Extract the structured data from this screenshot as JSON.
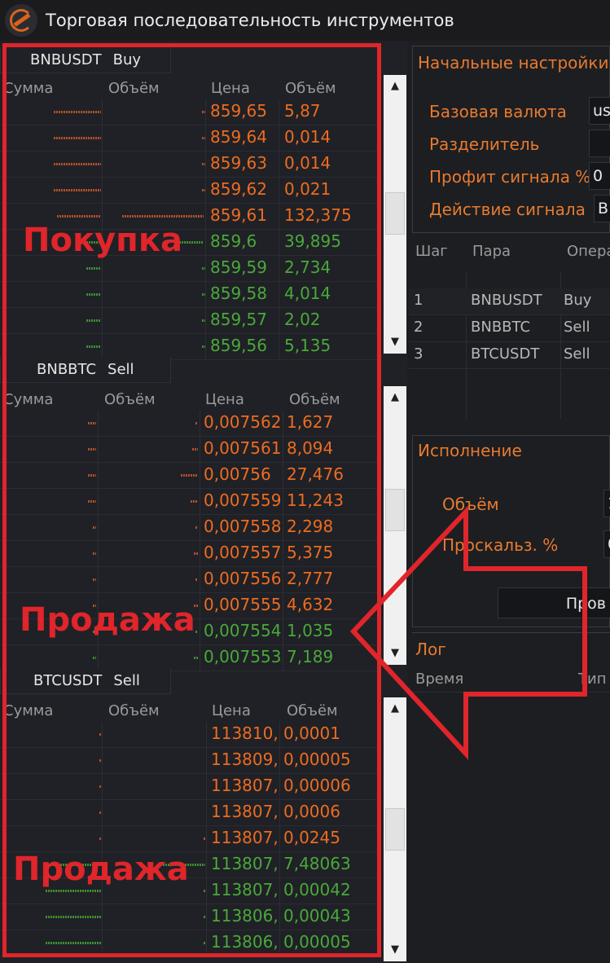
{
  "window": {
    "title": "Торговая последовательность инструментов"
  },
  "order_books": [
    {
      "pair": "BNBUSDT",
      "side": "Buy",
      "columns": [
        "Сумма",
        "Объём",
        "Цена",
        "Объём"
      ],
      "rows": [
        {
          "price": "859,65",
          "volume": "5,87",
          "kind": "sell"
        },
        {
          "price": "859,64",
          "volume": "0,014",
          "kind": "sell"
        },
        {
          "price": "859,63",
          "volume": "0,014",
          "kind": "sell"
        },
        {
          "price": "859,62",
          "volume": "0,021",
          "kind": "sell"
        },
        {
          "price": "859,61",
          "volume": "132,375",
          "kind": "sell"
        },
        {
          "price": "859,6",
          "volume": "39,895",
          "kind": "buy"
        },
        {
          "price": "859,59",
          "volume": "2,734",
          "kind": "buy"
        },
        {
          "price": "859,58",
          "volume": "4,014",
          "kind": "buy"
        },
        {
          "price": "859,57",
          "volume": "2,02",
          "kind": "buy"
        },
        {
          "price": "859,56",
          "volume": "5,135",
          "kind": "buy"
        }
      ]
    },
    {
      "pair": "BNBBTC",
      "side": "Sell",
      "columns": [
        "Сумма",
        "Объём",
        "Цена",
        "Объём"
      ],
      "rows": [
        {
          "price": "0,007562",
          "volume": "1,627",
          "kind": "sell"
        },
        {
          "price": "0,007561",
          "volume": "8,094",
          "kind": "sell"
        },
        {
          "price": "0,00756",
          "volume": "27,476",
          "kind": "sell"
        },
        {
          "price": "0,007559",
          "volume": "11,243",
          "kind": "sell"
        },
        {
          "price": "0,007558",
          "volume": "2,298",
          "kind": "sell"
        },
        {
          "price": "0,007557",
          "volume": "5,375",
          "kind": "sell"
        },
        {
          "price": "0,007556",
          "volume": "2,777",
          "kind": "sell"
        },
        {
          "price": "0,007555",
          "volume": "4,632",
          "kind": "sell"
        },
        {
          "price": "0,007554",
          "volume": "1,035",
          "kind": "buy"
        },
        {
          "price": "0,007553",
          "volume": "7,189",
          "kind": "buy"
        }
      ]
    },
    {
      "pair": "BTCUSDT",
      "side": "Sell",
      "columns": [
        "Сумма",
        "Объём",
        "Цена",
        "Объём"
      ],
      "rows": [
        {
          "price": "113810,",
          "volume": "0,0001",
          "kind": "sell"
        },
        {
          "price": "113809,",
          "volume": "0,00005",
          "kind": "sell"
        },
        {
          "price": "113807,",
          "volume": "0,00006",
          "kind": "sell"
        },
        {
          "price": "113807,",
          "volume": "0,0006",
          "kind": "sell"
        },
        {
          "price": "113807,",
          "volume": "0,0245",
          "kind": "sell"
        },
        {
          "price": "113807,",
          "volume": "7,48063",
          "kind": "buy"
        },
        {
          "price": "113807,",
          "volume": "0,00042",
          "kind": "buy"
        },
        {
          "price": "113806,",
          "volume": "0,00043",
          "kind": "buy"
        },
        {
          "price": "113806,",
          "volume": "0,00005",
          "kind": "buy"
        }
      ]
    }
  ],
  "overlay_labels": {
    "buy": "Покупка",
    "sell_1": "Продажа",
    "sell_2": "Продажа"
  },
  "settings": {
    "title": "Начальные настройки",
    "base_currency_label": "Базовая валюта",
    "base_currency_value": "us",
    "separator_label": "Разделитель",
    "separator_value": "",
    "signal_profit_label": "Профит сигнала %",
    "signal_profit_value": "0",
    "signal_action_label": "Действие сигнала",
    "signal_action_value": "B"
  },
  "steps": {
    "columns": [
      "Шаг",
      "Пара",
      "Опера"
    ],
    "rows": [
      {
        "step": "1",
        "pair": "BNBUSDT",
        "op": "Buy"
      },
      {
        "step": "2",
        "pair": "BNBBTC",
        "op": "Sell"
      },
      {
        "step": "3",
        "pair": "BTCUSDT",
        "op": "Sell"
      }
    ]
  },
  "execution": {
    "title": "Исполнение",
    "volume_label": "Объём",
    "slippage_label": "Проскальз. %",
    "volume_value": "1",
    "slippage_value": "0",
    "check_button": "Пров"
  },
  "log": {
    "title": "Лог",
    "columns": [
      "Время",
      "Тип"
    ]
  },
  "colors": {
    "accent_orange": "#e87a2e",
    "sell_orange": "#ee6b20",
    "buy_green": "#4aa83a",
    "highlight_red": "#e0252b"
  }
}
